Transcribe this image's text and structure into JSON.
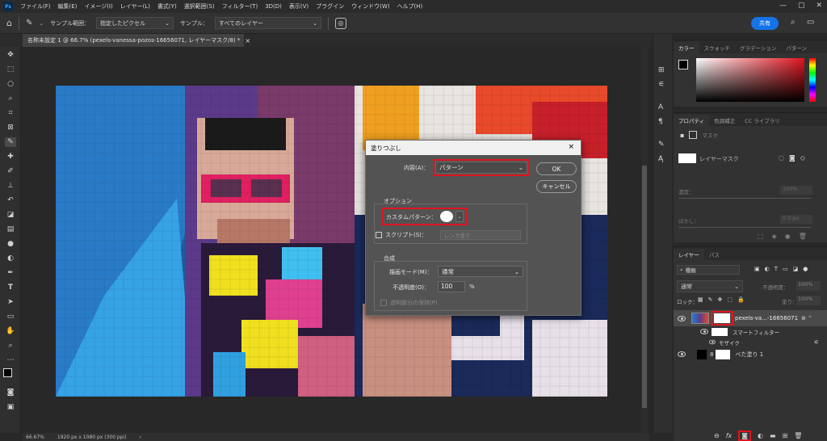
{
  "menu": {
    "app_icon": "Ps",
    "items": [
      "ファイル(F)",
      "編集(E)",
      "イメージ(I)",
      "レイヤー(L)",
      "書式(Y)",
      "選択範囲(S)",
      "フィルター(T)",
      "3D(D)",
      "表示(V)",
      "プラグイン",
      "ウィンドウ(W)",
      "ヘルプ(H)"
    ]
  },
  "options_bar": {
    "sample_size_label": "サンプル範囲：",
    "sample_size_value": "指定したピクセル",
    "sample_label": "サンプル：",
    "sample_value": "すべてのレイヤー",
    "share_label": "共有"
  },
  "document_tab": {
    "title": "名称未設定 1 @ 66.7% (pexels-vanessa-pozos-16656071, レイヤーマスク/8) *",
    "close": "×"
  },
  "status_bar": {
    "zoom": "66.67%",
    "doc_info": "1920 px x 1080 px (300 ppi)"
  },
  "color_panel": {
    "tabs": [
      "カラー",
      "スウォッチ",
      "グラデーション",
      "パターン"
    ],
    "active_tab": 0
  },
  "properties_panel": {
    "tabs": [
      "プロパティ",
      "色調補正",
      "CC ライブラリ"
    ],
    "active_tab": 0,
    "section_label": "マスク",
    "mask_label": "レイヤーマスク",
    "density_label": "濃度：",
    "density_value": "100%",
    "feather_label": "ぼかし：",
    "feather_value": "0.0 px"
  },
  "layers_panel": {
    "tabs": [
      "レイヤー",
      "パス"
    ],
    "active_tab": 0,
    "search_placeholder": "種類",
    "blend_mode": "通常",
    "opacity_label": "不透明度：",
    "opacity_value": "100%",
    "lock_label": "ロック：",
    "fill_label": "塗り：",
    "fill_value": "100%",
    "layers": [
      {
        "name": "pexels-va...-16656071",
        "type": "smart-object"
      },
      {
        "name": "スマートフィルター",
        "type": "filter-group"
      },
      {
        "name": "モザイク",
        "type": "filter"
      },
      {
        "name": "べた塗り 1",
        "type": "fill"
      }
    ],
    "footer_icons": [
      "link-icon",
      "fx-icon",
      "mask-icon",
      "adjustment-icon",
      "folder-icon",
      "new-layer-icon",
      "trash-icon"
    ]
  },
  "fill_dialog": {
    "title": "塗りつぶし",
    "close": "×",
    "contents_label": "内容(A)：",
    "contents_value": "パターン",
    "ok_label": "OK",
    "cancel_label": "キャンセル",
    "options_group_label": "オプション",
    "custom_pattern_label": "カスタムパターン：",
    "script_label": "スクリプト(S)：",
    "script_value": "レンガ塗り",
    "blending_group_label": "合成",
    "mode_label": "描画モード(M)：",
    "mode_value": "通常",
    "opacity_label": "不透明度(O)：",
    "opacity_value": "100",
    "opacity_unit": "%",
    "preserve_label": "透明部分の保持(P)"
  },
  "colors": {
    "highlight_red": "#e0141e",
    "accent_blue": "#1473e6"
  }
}
